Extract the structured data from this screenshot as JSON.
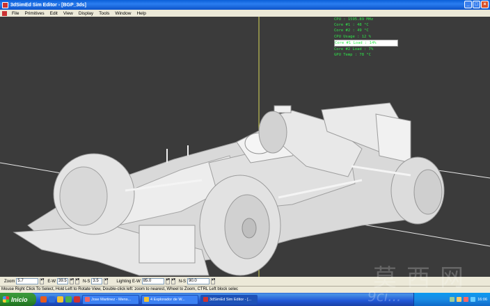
{
  "window": {
    "title": "3dSimEd Sim Editor - [BGP_3ds]",
    "minimize": "_",
    "maximize": "□",
    "close": "×"
  },
  "menu": [
    "File",
    "Primitives",
    "Edit",
    "View",
    "Display",
    "Tools",
    "Window",
    "Help"
  ],
  "overlay_stats": [
    "CPU : 1595.89 MHz",
    "Core #1 : 48 °C",
    "Core #2 : 49 °C",
    "CPU Usage : 12 %",
    "Core #1 Load : 14%",
    "Core #2 Load : 7%",
    "GPU Temp : 78 °C"
  ],
  "params": {
    "zoom_label": "Zoom",
    "zoom_value": "5.7",
    "ew_label": "E-W",
    "ew_value": "39.5",
    "ns_label": "N-S",
    "ns_value": "3.5",
    "lighting_label": "Lighting E-W",
    "lighting_ew_value": "85.0",
    "lighting_ns_label": "N-S",
    "lighting_ns_value": "90.0"
  },
  "status_text": "Mouse Right Click To Select, Hold Left to Rotate View, Double-click left: zoom to nearest, Wheel to Zoom, CTRL Left block selec",
  "taskbar": {
    "start_label": "Inicio",
    "tasks": [
      {
        "label": "Jose Martinez - Mens..."
      },
      {
        "label": "4 Explorador de W..."
      },
      {
        "label": "3dSimEd Sim Editor - [..."
      }
    ],
    "clock": "16:06"
  },
  "watermark": {
    "text_cn": "莫西网",
    "url": "9ci..."
  },
  "colors": {
    "titlebar": "#0a5fd8",
    "viewport_bg": "#3b3b3b",
    "overlay_text": "#2ee84a",
    "axis_yellow": "#d8d85a",
    "axis_white": "#e8e8e8"
  }
}
